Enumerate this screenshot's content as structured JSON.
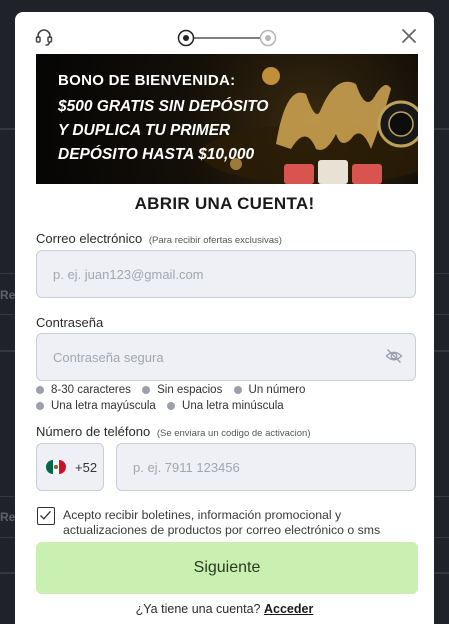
{
  "background": {
    "fragments": [
      "Reg",
      "Reg"
    ]
  },
  "modal": {
    "stepper": {
      "current_step": 1,
      "total_steps": 2
    },
    "banner": {
      "line1": "BONO DE BIENVENIDA:",
      "line2": "$500 GRATIS SIN DEPÓSITO",
      "line3": "Y DUPLICA TU PRIMER",
      "line4": "DEPÓSITO HASTA $10,000"
    },
    "title": "ABRIR UNA CUENTA!",
    "email": {
      "label": "Correo electrónico",
      "hint": "(Para recibir ofertas exclusivas)",
      "placeholder": "p. ej. juan123@gmail.com",
      "value": ""
    },
    "password": {
      "label": "Contraseña",
      "placeholder": "Contraseña segura",
      "value": "",
      "rules": [
        "8-30 caracteres",
        "Sin espacios",
        "Un número",
        "Una letra mayúscula",
        "Una letra minúscula"
      ]
    },
    "phone": {
      "label": "Número de teléfono",
      "hint": "(Se enviara un codigo de activacion)",
      "country_code": "+52",
      "placeholder": "p. ej. 7911 123456",
      "value": ""
    },
    "consent": {
      "checked": true,
      "text": "Acepto recibir boletines, información promocional y actualizaciones de productos por correo electrónico o sms"
    },
    "next_button": "Siguiente",
    "login_prompt": "¿Ya tiene una cuenta?",
    "login_link": "Acceder"
  },
  "colors": {
    "overlay": "#1f2329",
    "input_bg": "#eef0f6",
    "button_bg": "#c9efb1",
    "rule_dot": "#9aa1ad"
  },
  "icons": [
    "headset-icon",
    "close-icon",
    "eye-slash-icon",
    "mexico-flag-icon",
    "checkmark-icon"
  ]
}
